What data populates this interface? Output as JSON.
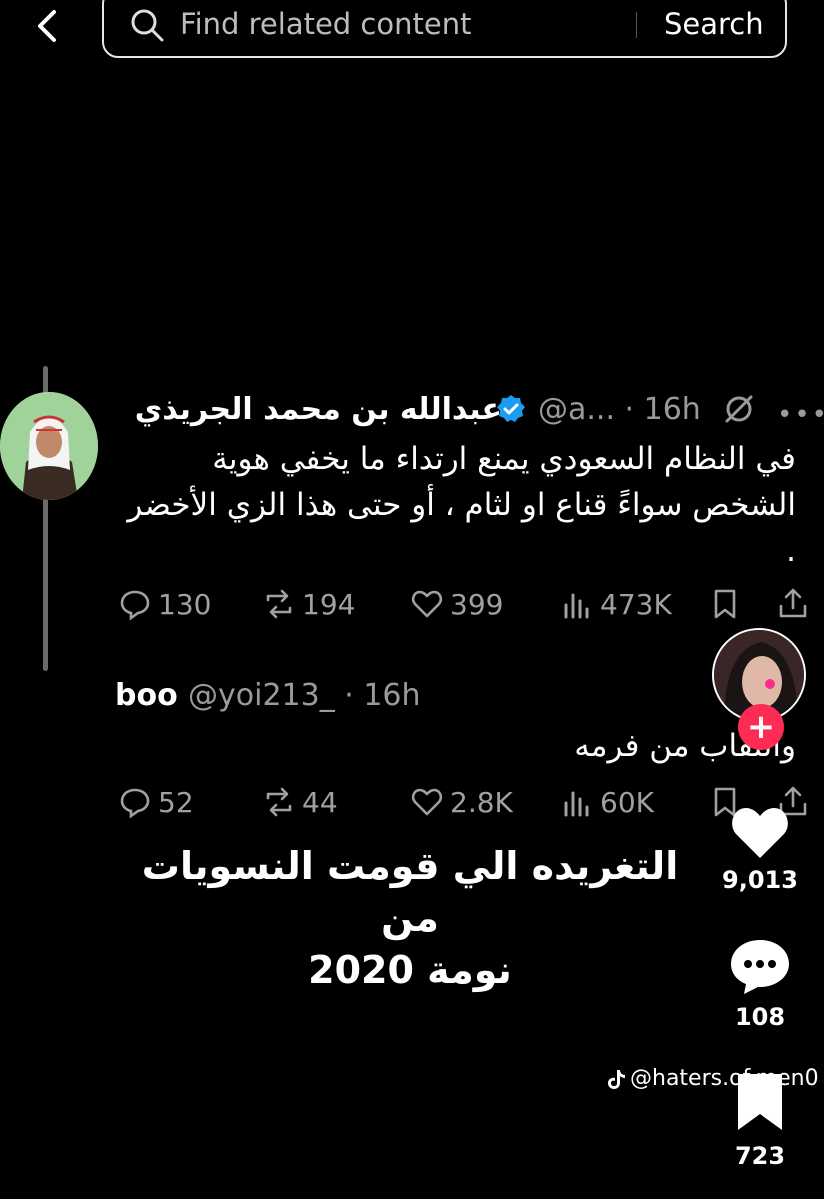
{
  "search": {
    "placeholder": "Find related content",
    "button_label": "Search"
  },
  "tweet": {
    "author_name": "عبدالله بن محمد الجريذي",
    "handle": "@a... · 16h",
    "text_line1": "في النظام السعودي يمنع ارتداء ما يخفي هوية",
    "text_line2": "الشخص سواءً قناع او لثام ، أو حتى هذا الزي الأخضر",
    "text_line3": ".",
    "stats": {
      "replies": "130",
      "reposts": "194",
      "likes": "399",
      "views": "473K"
    }
  },
  "reply": {
    "author_name": "boo",
    "handle": "@yoi213_ · 16h",
    "text": "والنقاب من فرمه",
    "stats": {
      "replies": "52",
      "reposts": "44",
      "likes": "2.8K",
      "views": "60K"
    }
  },
  "caption": {
    "line1": "التغريده الي قومت النسويات من",
    "line2": "نومة 2020"
  },
  "sidebar": {
    "likes": "9,013",
    "comments": "108",
    "saves": "723",
    "watermark": "@haters.of.men0"
  },
  "colors": {
    "background": "#000000",
    "verified": "#1d9bf0",
    "follow": "#fe2c55",
    "muted": "#9a9a9a"
  }
}
